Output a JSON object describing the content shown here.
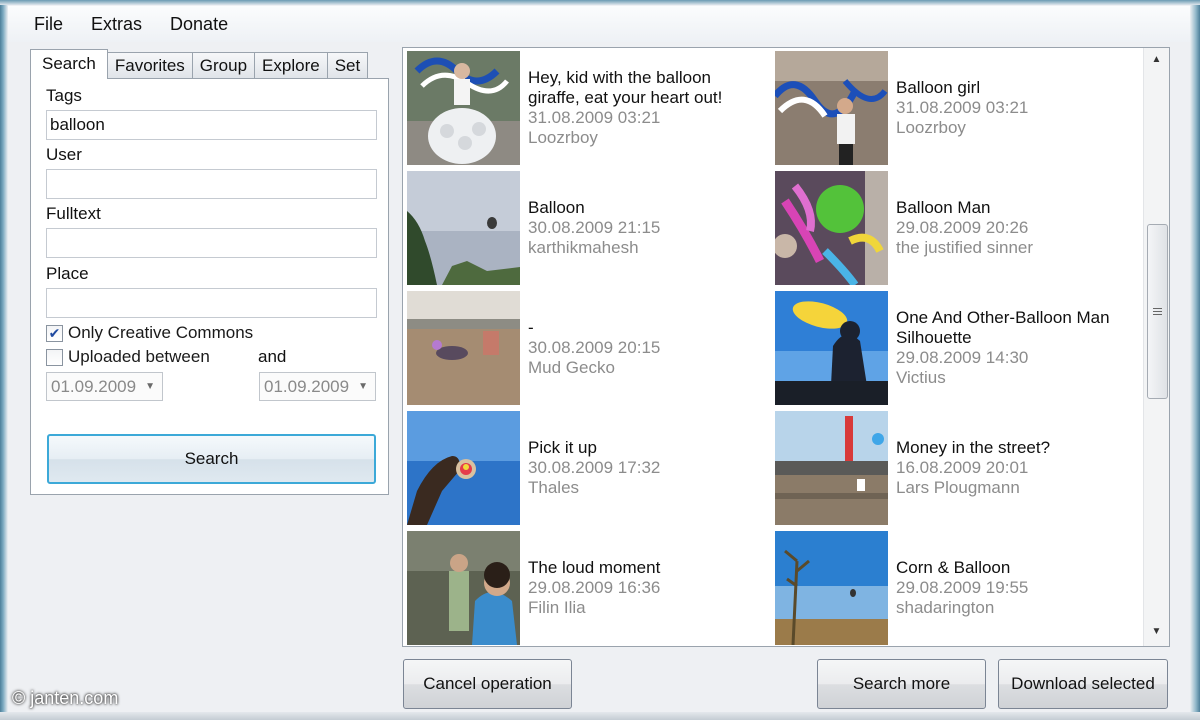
{
  "menu": [
    "File",
    "Extras",
    "Donate"
  ],
  "tabs": [
    "Search",
    "Favorites",
    "Group",
    "Explore",
    "Set"
  ],
  "search_form": {
    "tags_label": "Tags",
    "tags_value": "balloon",
    "user_label": "User",
    "user_value": "",
    "fulltext_label": "Fulltext",
    "fulltext_value": "",
    "place_label": "Place",
    "place_value": "",
    "creative_commons_label": "Only Creative Commons",
    "creative_commons_checked": true,
    "uploaded_between_label": "Uploaded between",
    "uploaded_between_checked": false,
    "and_label": "and",
    "date_from": "01.09.2009",
    "date_to": "01.09.2009",
    "search_button": "Search"
  },
  "results": [
    {
      "title": "Hey, kid with the balloon giraffe, eat your heart out!",
      "date": "31.08.2009 03:21",
      "user": "Loozrboy"
    },
    {
      "title": "Balloon girl",
      "date": "31.08.2009 03:21",
      "user": "Loozrboy"
    },
    {
      "title": "Balloon",
      "date": "30.08.2009 21:15",
      "user": "karthikmahesh"
    },
    {
      "title": "Balloon Man",
      "date": "29.08.2009 20:26",
      "user": "the justified sinner"
    },
    {
      "title": "-",
      "date": "30.08.2009 20:15",
      "user": "Mud Gecko"
    },
    {
      "title": "One And Other-Balloon Man Silhouette",
      "date": "29.08.2009 14:30",
      "user": "Victius"
    },
    {
      "title": "Pick it up",
      "date": "30.08.2009 17:32",
      "user": "Thales"
    },
    {
      "title": "Money in the street?",
      "date": "16.08.2009 20:01",
      "user": "Lars Plougmann"
    },
    {
      "title": "The loud moment",
      "date": "29.08.2009 16:36",
      "user": "Filin Ilia"
    },
    {
      "title": "Corn & Balloon",
      "date": "29.08.2009 19:55",
      "user": "shadarington"
    }
  ],
  "buttons": {
    "cancel": "Cancel operation",
    "search_more": "Search more",
    "download_selected": "Download selected"
  },
  "watermark": "© janten.com"
}
